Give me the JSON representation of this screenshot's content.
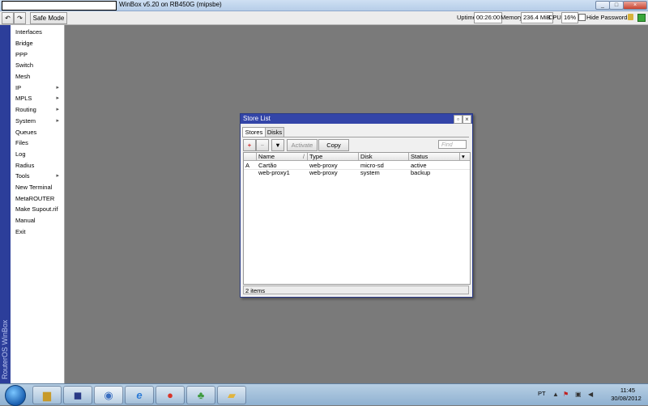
{
  "window": {
    "title": "WinBox v5.20 on RB450G (mipsbe)",
    "controls": [
      "_",
      "□",
      "×"
    ]
  },
  "toolbar": {
    "undo_icon": "undo-icon",
    "redo_icon": "redo-icon",
    "safe_mode": "Safe Mode",
    "uptime_label": "Uptime:",
    "uptime": "00:26:00",
    "memory_label": "Memory:",
    "memory": "236.4 MiB",
    "cpu_label": "CPU:",
    "cpu": "16%",
    "hide_passwords": "Hide Passwords"
  },
  "sidebar": {
    "brand": "RouterOS WinBox",
    "items": [
      {
        "label": "Interfaces"
      },
      {
        "label": "Bridge"
      },
      {
        "label": "PPP"
      },
      {
        "label": "Switch"
      },
      {
        "label": "Mesh"
      },
      {
        "label": "IP",
        "submenu": true
      },
      {
        "label": "MPLS",
        "submenu": true
      },
      {
        "label": "Routing",
        "submenu": true
      },
      {
        "label": "System",
        "submenu": true
      },
      {
        "label": "Queues"
      },
      {
        "label": "Files"
      },
      {
        "label": "Log"
      },
      {
        "label": "Radius"
      },
      {
        "label": "Tools",
        "submenu": true
      },
      {
        "label": "New Terminal"
      },
      {
        "label": "MetaROUTER"
      },
      {
        "label": "Make Supout.rif"
      },
      {
        "label": "Manual"
      },
      {
        "label": "Exit"
      }
    ]
  },
  "dialog": {
    "title": "Store List",
    "tabs": [
      "Stores",
      "Disks"
    ],
    "buttons": {
      "add_icon": "plus-icon",
      "remove_icon": "minus-icon",
      "filter_icon": "filter-icon",
      "activate": "Activate",
      "copy": "Copy"
    },
    "find_placeholder": "Find",
    "columns": [
      "Name",
      "Type",
      "Disk",
      "Status"
    ],
    "rows": [
      {
        "flag": "A",
        "name": "Cartão",
        "type": "web-proxy",
        "disk": "micro-sd",
        "status": "active"
      },
      {
        "flag": "",
        "name": "web-proxy1",
        "type": "web-proxy",
        "disk": "system",
        "status": "backup"
      }
    ],
    "status": "2 items"
  },
  "taskbar": {
    "apps": [
      "explorer-icon",
      "winbox-icon",
      "chrome-icon",
      "ie-icon",
      "chat-icon",
      "folder-icon"
    ],
    "language": "PT",
    "time": "11:45",
    "date": "30/08/2012"
  }
}
